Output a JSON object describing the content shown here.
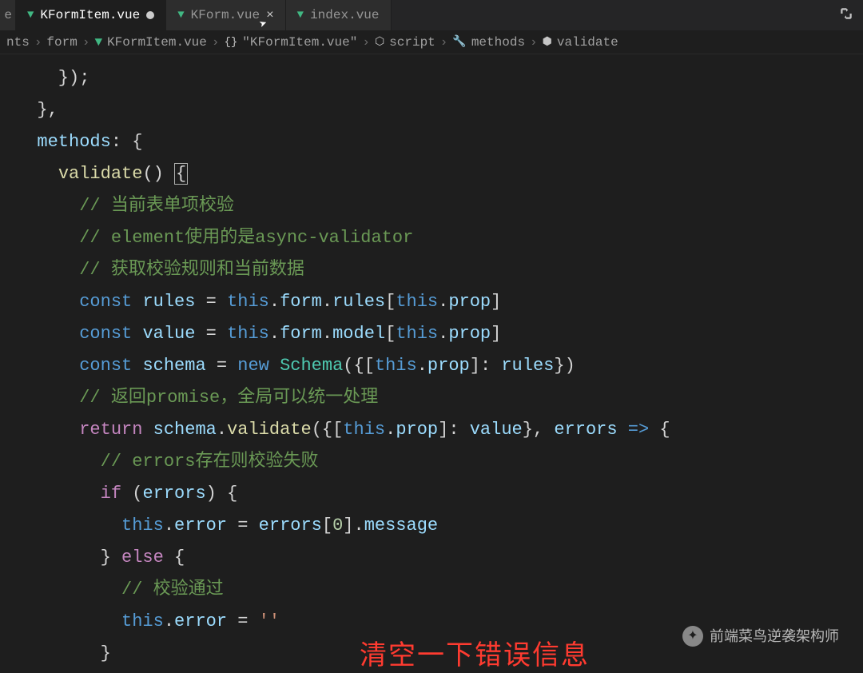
{
  "tabs": {
    "edge": "e",
    "t1": {
      "name": "KFormItem.vue",
      "dirty": true,
      "active": true
    },
    "t2": {
      "name": "KForm.vue",
      "dirty": false,
      "active": false
    },
    "t3": {
      "name": "index.vue",
      "dirty": false,
      "active": false
    }
  },
  "breadcrumbs": {
    "b1": "nts",
    "b2": "form",
    "b3": "KFormItem.vue",
    "b4": "{}",
    "b5": "\"KFormItem.vue\"",
    "b6": "script",
    "b7": "methods",
    "b8": "validate",
    "sep": "›"
  },
  "code": {
    "l1a": "    });",
    "l2a": "  },",
    "l3_methods": "methods",
    "l3_colon": ": {",
    "l4_validate": "validate",
    "l4_paren": "() ",
    "l4_brace": "{",
    "c1": "// 当前表单项校验",
    "c2": "// element使用的是async-validator",
    "c3": "// 获取校验规则和当前数据",
    "const": "const",
    "rules": "rules",
    "value": "value",
    "schema": "schema",
    "eq": " = ",
    "this": "this",
    "form": "form",
    "rules_prop": "rules",
    "model_prop": "model",
    "prop": "prop",
    "new": "new",
    "Schema": "Schema",
    "c4": "// 返回promise，全局可以统一处理",
    "return": "return",
    "validate_call": "validate",
    "errors": "errors",
    "arrow": "=>",
    "c5": "// errors存在则校验失败",
    "if": "if",
    "error": "error",
    "zero": "0",
    "message": "message",
    "else": "else",
    "c6": "// 校验通过",
    "empty_str": "''"
  },
  "overlay": "清空一下错误信息",
  "watermark": "前端菜鸟逆袭架构师"
}
